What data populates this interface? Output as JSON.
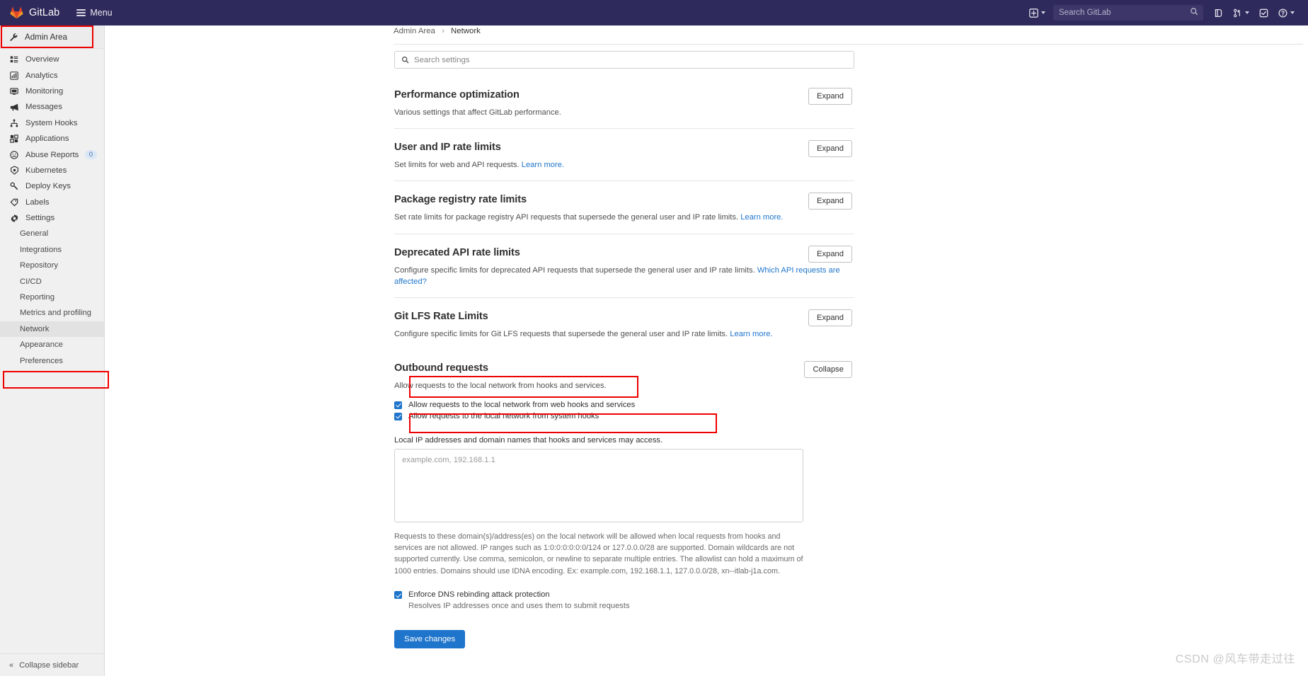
{
  "navbar": {
    "brand": "GitLab",
    "menu_label": "Menu",
    "search_placeholder": "Search GitLab",
    "icons": {
      "plus": "plus-square-icon",
      "plus_caret": "chevron-down-icon",
      "search": "search-icon",
      "issues": "issues-icon",
      "merge_requests": "merge-request-icon",
      "mr_caret": "chevron-down-icon",
      "todos": "todo-check-icon",
      "help": "help-circle-icon",
      "help_caret": "chevron-down-icon"
    }
  },
  "sidebar": {
    "header": {
      "label": "Admin Area",
      "icon": "wrench-icon"
    },
    "items": [
      {
        "label": "Overview",
        "icon": "overview-list-icon"
      },
      {
        "label": "Analytics",
        "icon": "chart-bar-icon"
      },
      {
        "label": "Monitoring",
        "icon": "monitor-icon"
      },
      {
        "label": "Messages",
        "icon": "megaphone-icon"
      },
      {
        "label": "System Hooks",
        "icon": "hook-icon"
      },
      {
        "label": "Applications",
        "icon": "apps-grid-icon"
      },
      {
        "label": "Abuse Reports",
        "icon": "abuse-face-icon",
        "badge": "0"
      },
      {
        "label": "Kubernetes",
        "icon": "kubernetes-icon"
      },
      {
        "label": "Deploy Keys",
        "icon": "key-icon"
      },
      {
        "label": "Labels",
        "icon": "label-tag-icon"
      },
      {
        "label": "Settings",
        "icon": "gear-icon"
      }
    ],
    "sub_items": [
      {
        "label": "General",
        "active": false
      },
      {
        "label": "Integrations",
        "active": false
      },
      {
        "label": "Repository",
        "active": false
      },
      {
        "label": "CI/CD",
        "active": false
      },
      {
        "label": "Reporting",
        "active": false
      },
      {
        "label": "Metrics and profiling",
        "active": false
      },
      {
        "label": "Network",
        "active": true
      },
      {
        "label": "Appearance",
        "active": false
      },
      {
        "label": "Preferences",
        "active": false
      }
    ],
    "collapse_label": "Collapse sidebar",
    "collapse_icon": "double-chevron-left-icon"
  },
  "breadcrumb": {
    "root": "Admin Area",
    "separator": "›",
    "current": "Network"
  },
  "settings_search": {
    "placeholder": "Search settings",
    "value": "",
    "icon": "search-icon"
  },
  "sections": [
    {
      "title": "Performance optimization",
      "desc": "Various settings that affect GitLab performance.",
      "link": "",
      "button": "Expand"
    },
    {
      "title": "User and IP rate limits",
      "desc": "Set limits for web and API requests.",
      "link": "Learn more.",
      "button": "Expand"
    },
    {
      "title": "Package registry rate limits",
      "desc": "Set rate limits for package registry API requests that supersede the general user and IP rate limits.",
      "link": "Learn more.",
      "button": "Expand"
    },
    {
      "title": "Deprecated API rate limits",
      "desc": "Configure specific limits for deprecated API requests that supersede the general user and IP rate limits.",
      "link": "Which API requests are affected?",
      "button": "Expand"
    },
    {
      "title": "Git LFS Rate Limits",
      "desc": "Configure specific limits for Git LFS requests that supersede the general user and IP rate limits.",
      "link": "Learn more.",
      "button": "Expand"
    }
  ],
  "outbound": {
    "title": "Outbound requests",
    "desc": "Allow requests to the local network from hooks and services.",
    "button": "Collapse",
    "checkbox_webhooks": {
      "label": "Allow requests to the local network from web hooks and services",
      "checked": true
    },
    "checkbox_systemhooks": {
      "label": "Allow requests to the local network from system hooks",
      "checked": true
    },
    "allowlist_label": "Local IP addresses and domain names that hooks and services may access.",
    "allowlist_placeholder": "example.com, 192.168.1.1",
    "allowlist_value": "",
    "help_text": "Requests to these domain(s)/address(es) on the local network will be allowed when local requests from hooks and services are not allowed. IP ranges such as 1:0:0:0:0:0:0/124 or 127.0.0.0/28 are supported. Domain wildcards are not supported currently. Use comma, semicolon, or newline to separate multiple entries. The allowlist can hold a maximum of 1000 entries. Domains should use IDNA encoding. Ex: example.com, 192.168.1.1, 127.0.0.0/28, xn--itlab-j1a.com.",
    "checkbox_dns": {
      "label": "Enforce DNS rebinding attack protection",
      "sublabel": "Resolves IP addresses once and uses them to submit requests",
      "checked": true
    },
    "save_label": "Save changes"
  },
  "watermark": "CSDN @风车带走过往",
  "colors": {
    "navbar": "#2e2a5b",
    "accent": "#1f75cb",
    "sidebar": "#f0f0f0",
    "highlight": "#ef0000",
    "badge_bg": "#dbe7f5"
  }
}
